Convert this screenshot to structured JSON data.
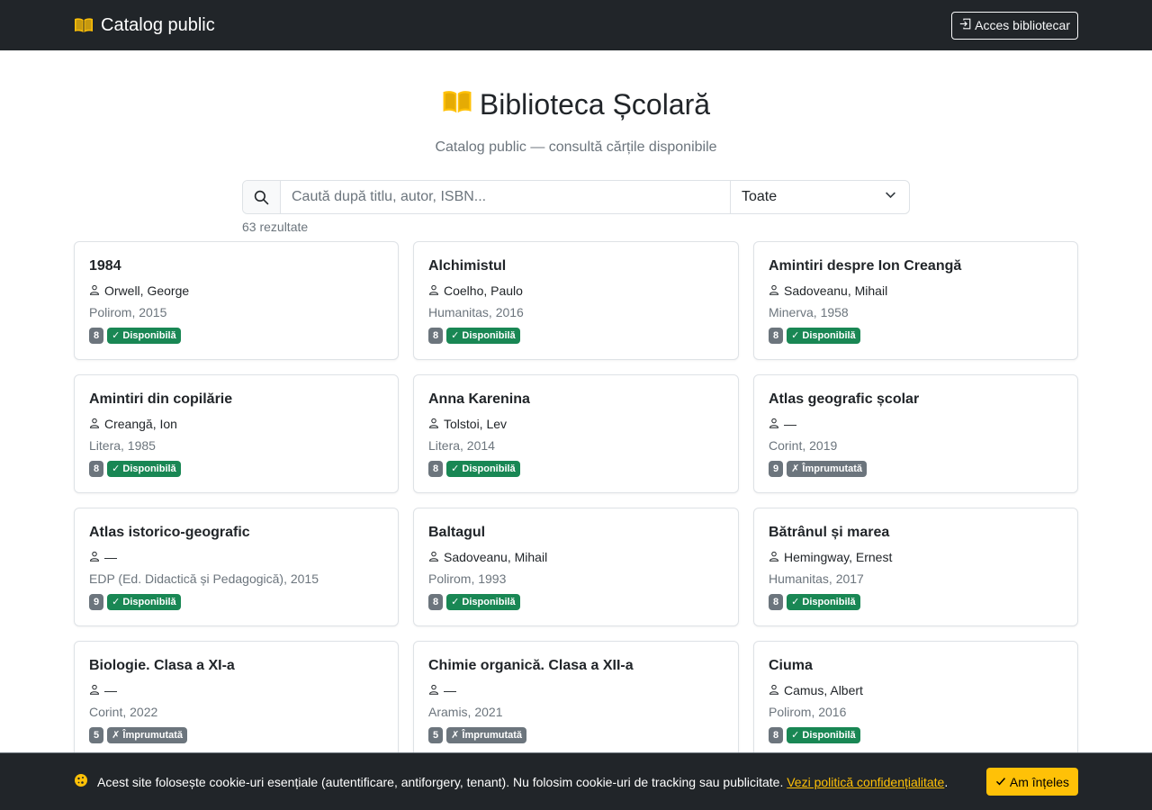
{
  "navbar": {
    "brand": "Catalog public",
    "login_label": "Acces bibliotecar"
  },
  "hero": {
    "title": "Biblioteca Școlară",
    "subtitle": "Catalog public — consultă cărțile disponibile"
  },
  "search": {
    "placeholder": "Caută după titlu, autor, ISBN...",
    "filter_value": "Toate",
    "results_count": "63 rezultate"
  },
  "books": [
    {
      "title": "1984",
      "author": "Orwell, George",
      "publisher": "Polirom, 2015",
      "count": "8",
      "status": "✓ Disponibilă",
      "available": true
    },
    {
      "title": "Alchimistul",
      "author": "Coelho, Paulo",
      "publisher": "Humanitas, 2016",
      "count": "8",
      "status": "✓ Disponibilă",
      "available": true
    },
    {
      "title": "Amintiri despre Ion Creangă",
      "author": "Sadoveanu, Mihail",
      "publisher": "Minerva, 1958",
      "count": "8",
      "status": "✓ Disponibilă",
      "available": true
    },
    {
      "title": "Amintiri din copilărie",
      "author": "Creangă, Ion",
      "publisher": "Litera, 1985",
      "count": "8",
      "status": "✓ Disponibilă",
      "available": true
    },
    {
      "title": "Anna Karenina",
      "author": "Tolstoi, Lev",
      "publisher": "Litera, 2014",
      "count": "8",
      "status": "✓ Disponibilă",
      "available": true
    },
    {
      "title": "Atlas geografic școlar",
      "author": "—",
      "publisher": "Corint, 2019",
      "count": "9",
      "status": "✗ Împrumutată",
      "available": false
    },
    {
      "title": "Atlas istorico-geografic",
      "author": "—",
      "publisher": "EDP (Ed. Didactică și Pedagogică), 2015",
      "count": "9",
      "status": "✓ Disponibilă",
      "available": true
    },
    {
      "title": "Baltagul",
      "author": "Sadoveanu, Mihail",
      "publisher": "Polirom, 1993",
      "count": "8",
      "status": "✓ Disponibilă",
      "available": true
    },
    {
      "title": "Bătrânul și marea",
      "author": "Hemingway, Ernest",
      "publisher": "Humanitas, 2017",
      "count": "8",
      "status": "✓ Disponibilă",
      "available": true
    },
    {
      "title": "Biologie. Clasa a XI-a",
      "author": "—",
      "publisher": "Corint, 2022",
      "count": "5",
      "status": "✗ Împrumutată",
      "available": false
    },
    {
      "title": "Chimie organică. Clasa a XII-a",
      "author": "—",
      "publisher": "Aramis, 2021",
      "count": "5",
      "status": "✗ Împrumutată",
      "available": false
    },
    {
      "title": "Ciuma",
      "author": "Camus, Albert",
      "publisher": "Polirom, 2016",
      "count": "8",
      "status": "✓ Disponibilă",
      "available": true
    }
  ],
  "cookie": {
    "text": "Acest site folosește cookie-uri esențiale (autentificare, antiforgery, tenant). Nu folosim cookie-uri de tracking sau publicitate.",
    "link": "Vezi politică confidențialitate",
    "period": ".",
    "ok_label": "Am înțeles"
  },
  "colors": {
    "navbar": "#212529",
    "accent": "#ffc107",
    "success": "#198754",
    "secondary": "#6c757d"
  },
  "icons": {
    "brand": "open-book-icon",
    "login": "box-arrow-in-icon",
    "search": "search-icon",
    "select": "chevron-down-icon",
    "author": "person-icon",
    "cookie": "cookie-icon",
    "ok": "check-icon"
  }
}
